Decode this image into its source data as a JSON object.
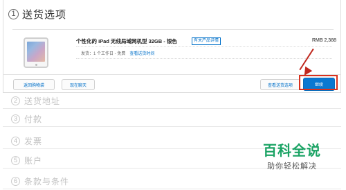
{
  "section_active": {
    "number": "1",
    "title": "送货选项"
  },
  "product": {
    "name": "个性化的 iPad 无线局域网机型 32GB - 银色",
    "details_link": "有关产品详情",
    "price": "RMB 2,388",
    "shipping_label": "发货：1 个工作日 - 免费",
    "shipping_link": "查看送货时间"
  },
  "buttons": {
    "back": "返回购物袋",
    "chat": "现在聊天",
    "more_options": "查看送货选项",
    "continue": "继续"
  },
  "steps": [
    {
      "number": "2",
      "label": "送货地址"
    },
    {
      "number": "3",
      "label": "付款"
    },
    {
      "number": "4",
      "label": "发票"
    },
    {
      "number": "5",
      "label": "账户"
    },
    {
      "number": "6",
      "label": "条款与条件"
    }
  ],
  "watermark": {
    "title": "百科全说",
    "subtitle": "助你轻松解决"
  },
  "colors": {
    "accent": "#0070c9",
    "continue_bg": "#0b78d1",
    "annotation_red": "#d9301c",
    "watermark_green": "#1aa364"
  }
}
